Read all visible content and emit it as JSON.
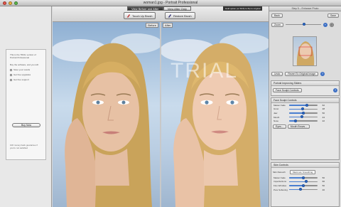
{
  "window": {
    "title": "woman1.jpg - Portrait Professional",
    "colors": {
      "close": "#e8564a",
      "minimize": "#efb33b",
      "zoom": "#5bb94c",
      "accent": "#3a6fc4"
    }
  },
  "left_panel": {
    "trial_text": "This is the TRIAL version of Portrait Professional",
    "trial_text2": "Buy the software, and you will:",
    "benefits": [
      "Save your results",
      "Get free upgrades",
      "Get free support"
    ],
    "buy_label": "Buy Now",
    "trial_footer": "100 money back guarantee if you're not satisfied"
  },
  "toolbar": {
    "tabs": [
      {
        "label": "View Before and After",
        "active": true
      },
      {
        "label": "View After Only",
        "active": false
      }
    ],
    "hint": "Hold option (or Shift) to flip to original",
    "touch_up_label": "Touch Up Brush",
    "restore_label": "Restore Brush"
  },
  "panes": {
    "before_label": "Before",
    "after_label": "After",
    "watermark": "TRIAL"
  },
  "right_panel": {
    "header": "Step 5 – Enhance Photo",
    "back_label": "Back",
    "save_label": "Save",
    "zoom_label": "Zoom",
    "undo_label": "Undo",
    "revert_label": "Revert To Original Image",
    "section_title": "Portrait Improving Sliders",
    "face_controls": {
      "title": "Face Sculpt Controls",
      "sliders": [
        {
          "label": "Master Fade",
          "value": 62
        },
        {
          "label": "Grow",
          "value": 48
        },
        {
          "label": "Jaw",
          "value": 50
        },
        {
          "label": "Mouth",
          "value": 44
        },
        {
          "label": "Nose",
          "value": 22
        }
      ],
      "eyes_label": "Eyes...",
      "mouth_label": "Mouth Brows..."
    },
    "skin_controls": {
      "title": "Skin Controls",
      "select_label": "Skin Retouch",
      "select_value": "Maximum Smoothing",
      "sliders": [
        {
          "label": "Master Fade",
          "value": 50
        },
        {
          "label": "Imperfections",
          "value": 60
        },
        {
          "label": "Fine Wrinkles",
          "value": 50
        },
        {
          "label": "Pore Softening",
          "value": 40
        }
      ]
    }
  }
}
